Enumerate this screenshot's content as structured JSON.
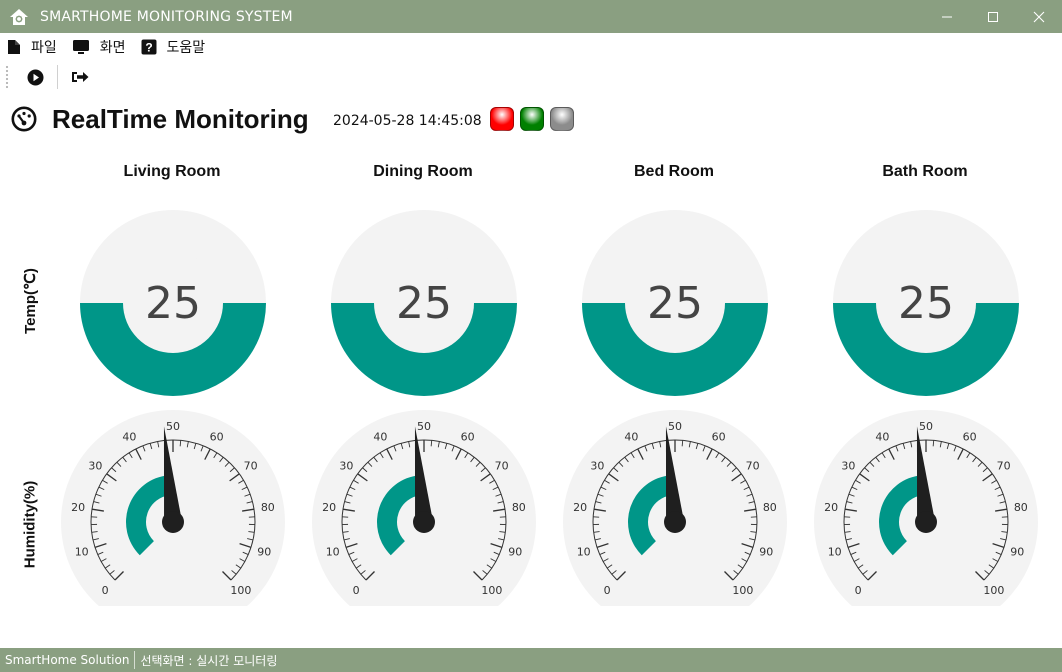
{
  "window": {
    "title": "SMARTHOME MONITORING SYSTEM",
    "title_bar_color": "#8a9f81"
  },
  "menu": {
    "items": [
      {
        "label": "파일",
        "icon": "file-icon"
      },
      {
        "label": "화면",
        "icon": "monitor-icon"
      },
      {
        "label": "도움말",
        "icon": "help-icon"
      }
    ]
  },
  "toolbar": {
    "buttons": [
      {
        "icon": "play-circle-icon"
      },
      {
        "icon": "sign-out-icon"
      }
    ]
  },
  "header": {
    "title": "RealTime Monitoring",
    "datetime": "2024-05-28 14:45:08",
    "indicators": [
      {
        "color": "#ff0000",
        "name": "red"
      },
      {
        "color": "#008000",
        "name": "green"
      },
      {
        "color": "#8c8c8c",
        "name": "gray"
      }
    ]
  },
  "row_labels": {
    "temperature": "Temp(℃)",
    "humidity": "Humidity(%)"
  },
  "rooms": [
    {
      "name": "Living Room",
      "temp": "25",
      "humidity": 48
    },
    {
      "name": "Dining Room",
      "temp": "25",
      "humidity": 48
    },
    {
      "name": "Bed Room",
      "temp": "25",
      "humidity": 48
    },
    {
      "name": "Bath Room",
      "temp": "25",
      "humidity": 48
    }
  ],
  "gauge": {
    "temp_fill_fraction": 0.5,
    "humidity_min": 0,
    "humidity_max": 100,
    "humidity_ticks": [
      "0",
      "10",
      "20",
      "30",
      "40",
      "50",
      "60",
      "70",
      "80",
      "90",
      "100"
    ],
    "accent_color": "#009688",
    "track_color": "#f3f3f3"
  },
  "status": {
    "app_name": "SmartHome Solution",
    "current_screen": "선택화면 : 실시간 모니터링"
  }
}
